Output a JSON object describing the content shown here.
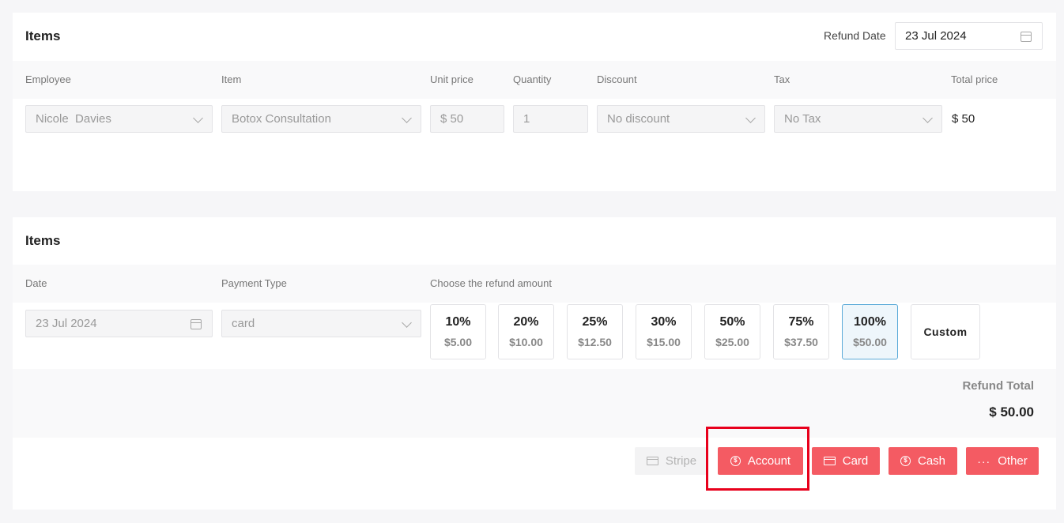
{
  "items_section": {
    "title": "Items",
    "refund_date_label": "Refund Date",
    "refund_date_value": "23 Jul 2024",
    "columns": [
      "Employee",
      "Item",
      "Unit price",
      "Quantity",
      "Discount",
      "Tax",
      "Total price"
    ],
    "row": {
      "employee": "Nicole  Davies",
      "item": "Botox Consultation",
      "unit_price": "$ 50",
      "quantity": "1",
      "discount": "No discount",
      "tax": "No Tax",
      "total_price": "$ 50"
    }
  },
  "refund_section": {
    "title": "Items",
    "date_label": "Date",
    "payment_type_label": "Payment Type",
    "refund_amount_label": "Choose the refund amount",
    "date_value": "23 Jul 2024",
    "payment_type_value": "card",
    "options": [
      {
        "percent": "10%",
        "amount": "$5.00"
      },
      {
        "percent": "20%",
        "amount": "$10.00"
      },
      {
        "percent": "25%",
        "amount": "$12.50"
      },
      {
        "percent": "30%",
        "amount": "$15.00"
      },
      {
        "percent": "50%",
        "amount": "$25.00"
      },
      {
        "percent": "75%",
        "amount": "$37.50"
      },
      {
        "percent": "100%",
        "amount": "$50.00"
      }
    ],
    "selected_option": "100%",
    "custom_label": "Custom",
    "refund_total_label": "Refund Total",
    "refund_total_value": "$ 50.00",
    "buttons": {
      "stripe": "Stripe",
      "account": "Account",
      "card": "Card",
      "cash": "Cash",
      "other": "Other"
    }
  },
  "colors": {
    "accent": "#f45b63",
    "selected_border": "#5aaad8",
    "highlight": "#e8001c"
  }
}
